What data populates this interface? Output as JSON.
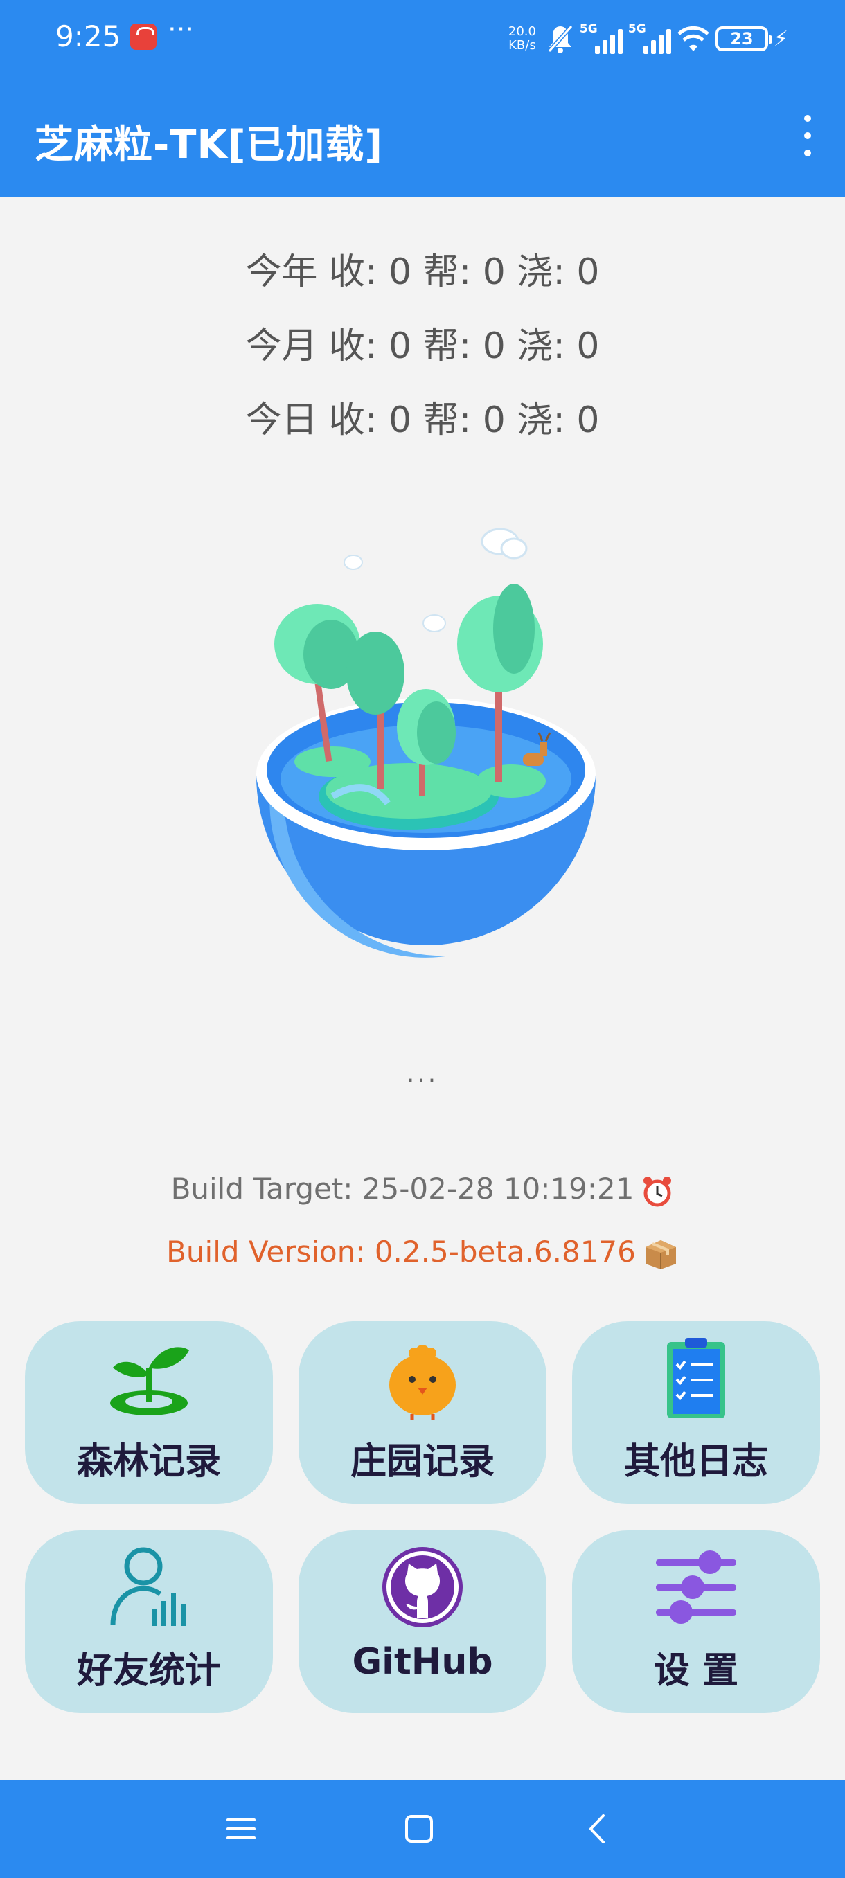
{
  "status_bar": {
    "time": "9:25",
    "more": "···",
    "net_speed_value": "20.0",
    "net_speed_unit": "KB/s",
    "sim1_label": "5G",
    "sim2_label": "5G",
    "battery": "23",
    "icons": [
      "huawei-app-icon",
      "bell-muted-icon",
      "signal-icon",
      "wifi-icon",
      "battery-icon",
      "charging-icon"
    ]
  },
  "app_bar": {
    "title": "芝麻粒-TK[已加载]",
    "overflow_icon": "more-vert-icon"
  },
  "stats": [
    {
      "period": "今年",
      "text": "今年  收: 0 帮: 0 浇: 0"
    },
    {
      "period": "今月",
      "text": "今月  收: 0 帮: 0 浇: 0"
    },
    {
      "period": "今日",
      "text": "今日  收: 0 帮: 0 浇: 0"
    }
  ],
  "hero_image": "forest-bowl-illustration",
  "loading_text": "...",
  "build": {
    "target": "Build Target: 25-02-28 10:19:21",
    "target_icon": "alarm-clock-icon",
    "version": "Build Version: 0.2.5-beta.6.8176",
    "version_icon": "package-icon"
  },
  "tiles": [
    {
      "label": "森林记录",
      "icon": "sprout-icon"
    },
    {
      "label": "庄园记录",
      "icon": "chick-icon"
    },
    {
      "label": "其他日志",
      "icon": "clipboard-icon"
    },
    {
      "label": "好友统计",
      "icon": "user-stats-icon"
    },
    {
      "label": "GitHub",
      "icon": "github-icon"
    },
    {
      "label": "设 置",
      "icon": "sliders-icon"
    }
  ],
  "nav_bar": {
    "icons": [
      "menu-icon",
      "home-icon",
      "back-icon"
    ]
  },
  "colors": {
    "primary": "#2b8af0",
    "tile_bg": "#c2e3ea",
    "build_version": "#e0622c",
    "tile_text": "#1f1a3c"
  }
}
